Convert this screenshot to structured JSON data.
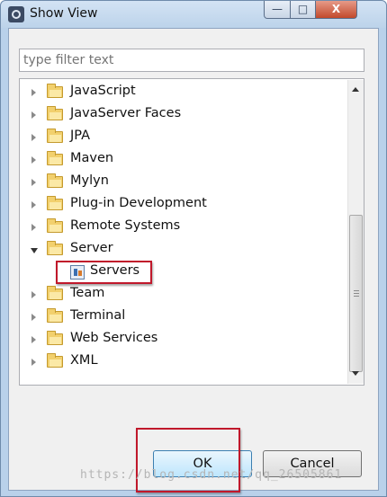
{
  "window": {
    "title": "Show View",
    "minimize_glyph": "—",
    "maximize_glyph": "□",
    "close_glyph": "X"
  },
  "filter": {
    "placeholder": "type filter text",
    "value": ""
  },
  "tree": {
    "items": [
      {
        "label": "JavaScript",
        "expanded": false,
        "icon": "folder-icon"
      },
      {
        "label": "JavaServer Faces",
        "expanded": false,
        "icon": "folder-icon"
      },
      {
        "label": "JPA",
        "expanded": false,
        "icon": "folder-icon"
      },
      {
        "label": "Maven",
        "expanded": false,
        "icon": "folder-icon"
      },
      {
        "label": "Mylyn",
        "expanded": false,
        "icon": "folder-icon"
      },
      {
        "label": "Plug-in Development",
        "expanded": false,
        "icon": "folder-icon"
      },
      {
        "label": "Remote Systems",
        "expanded": false,
        "icon": "folder-icon"
      },
      {
        "label": "Server",
        "expanded": true,
        "icon": "folder-icon"
      },
      {
        "label": "Servers",
        "child": true,
        "icon": "servers-view-icon"
      },
      {
        "label": "Team",
        "expanded": false,
        "icon": "folder-icon"
      },
      {
        "label": "Terminal",
        "expanded": false,
        "icon": "folder-icon"
      },
      {
        "label": "Web Services",
        "expanded": false,
        "icon": "folder-icon"
      },
      {
        "label": "XML",
        "expanded": false,
        "icon": "folder-icon"
      }
    ]
  },
  "buttons": {
    "ok_label": "OK",
    "cancel_label": "Cancel"
  },
  "watermark": "https://blog.csdn.net/qq_26505861",
  "colors": {
    "annotation_red": "#c0182b",
    "ok_button_accent": "#bee6fd"
  }
}
